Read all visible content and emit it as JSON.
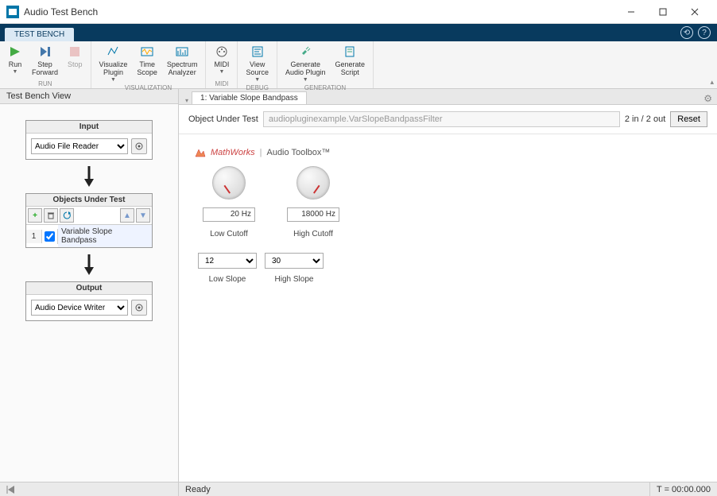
{
  "window": {
    "title": "Audio Test Bench"
  },
  "tabstrip": {
    "tab": "TEST BENCH"
  },
  "toolstrip": {
    "run": {
      "label": "Run"
    },
    "stepfwd": {
      "label": "Step\nForward"
    },
    "stop": {
      "label": "Stop"
    },
    "group_run": "RUN",
    "vizplugin": {
      "label": "Visualize\nPlugin"
    },
    "timescope": {
      "label": "Time\nScope"
    },
    "specan": {
      "label": "Spectrum\nAnalyzer"
    },
    "group_viz": "VISUALIZATION",
    "midi": {
      "label": "MIDI"
    },
    "group_midi": "MIDI",
    "viewsrc": {
      "label": "View\nSource"
    },
    "group_debug": "DEBUG",
    "genplugin": {
      "label": "Generate\nAudio Plugin"
    },
    "genscript": {
      "label": "Generate\nScript"
    },
    "group_gen": "GENERATION"
  },
  "left": {
    "header": "Test Bench View",
    "input": {
      "title": "Input",
      "selected": "Audio File Reader"
    },
    "objects": {
      "title": "Objects Under Test",
      "rows": [
        {
          "idx": "1",
          "name": "Variable Slope Bandpass"
        }
      ]
    },
    "output": {
      "title": "Output",
      "selected": "Audio Device Writer"
    }
  },
  "doc": {
    "tab": "1: Variable Slope Bandpass",
    "objlabel": "Object Under Test",
    "objvalue": "audiopluginexample.VarSlopeBandpassFilter",
    "io": "2 in / 2 out",
    "reset": "Reset"
  },
  "brand": {
    "mathworks": "MathWorks",
    "toolbox": "Audio Toolbox™"
  },
  "plugin": {
    "lowcut": {
      "value": "20 Hz",
      "label": "Low Cutoff"
    },
    "highcut": {
      "value": "18000 Hz",
      "label": "High Cutoff"
    },
    "lowslope": {
      "value": "12",
      "label": "Low Slope"
    },
    "highslope": {
      "value": "30",
      "label": "High Slope"
    }
  },
  "status": {
    "ready": "Ready",
    "time": "T = 00:00.000"
  }
}
